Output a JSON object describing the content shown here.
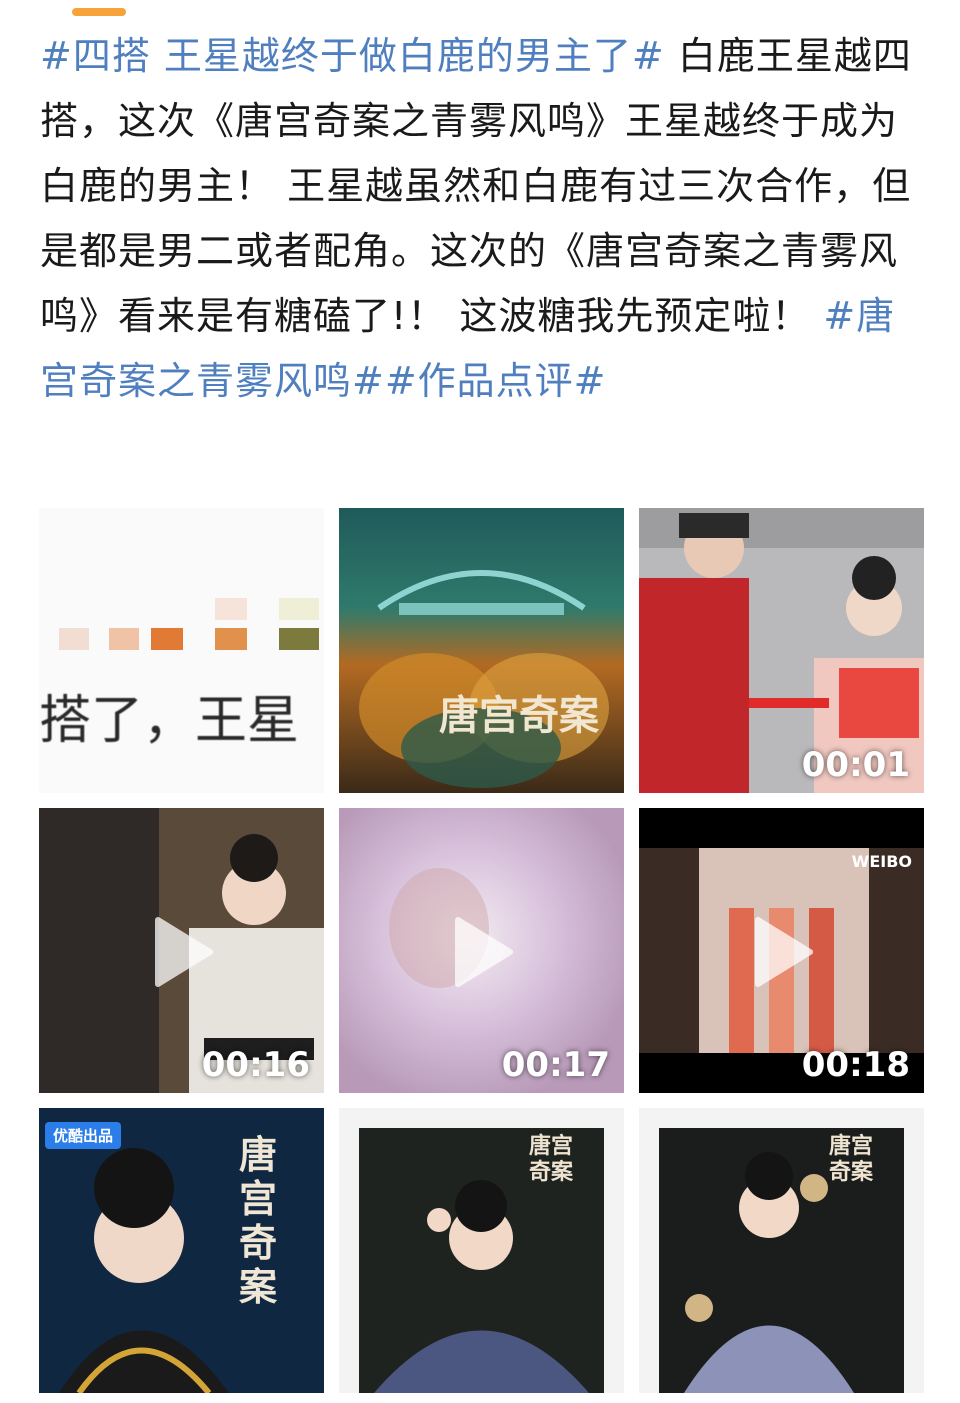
{
  "post": {
    "tag_opening": "#四搭 王星越终于做白鹿的男主了#",
    "body_text": " 白鹿王星越四搭，这次《唐宫奇案之青雾风鸣》王星越终于成为白鹿的男主！ 王星越虽然和白鹿有过三次合作，但是都是男二或者配角。这次的《唐宫奇案之青雾风鸣》看来是有糖磕了!！ 这波糖我先预定啦！ ",
    "tag_drama": "#唐宫奇案之青雾风鸣#",
    "tag_review": "#作品点评#"
  },
  "media": [
    {
      "kind": "image",
      "caption_text": "搭了，王星",
      "icon": "image-thumbnail"
    },
    {
      "kind": "image",
      "poster_title": "唐宫奇案",
      "icon": "image-thumbnail"
    },
    {
      "kind": "video",
      "duration": "00:01",
      "icon": "video-thumbnail"
    },
    {
      "kind": "video",
      "duration": "00:16",
      "icon": "play-icon"
    },
    {
      "kind": "video",
      "duration": "00:17",
      "icon": "play-icon"
    },
    {
      "kind": "video",
      "duration": "00:18",
      "icon": "play-icon",
      "watermark": "WEIBO"
    },
    {
      "kind": "image",
      "badge": "优酷出品",
      "poster_title": "唐宫奇案",
      "icon": "image-thumbnail"
    },
    {
      "kind": "image",
      "poster_title": "唐宫奇案",
      "icon": "image-thumbnail"
    },
    {
      "kind": "image",
      "poster_title": "唐宫奇案",
      "icon": "image-thumbnail"
    }
  ],
  "colors": {
    "tag": "#4f7fbf",
    "accent": "#f7a33a",
    "text": "#1a1a1a"
  }
}
